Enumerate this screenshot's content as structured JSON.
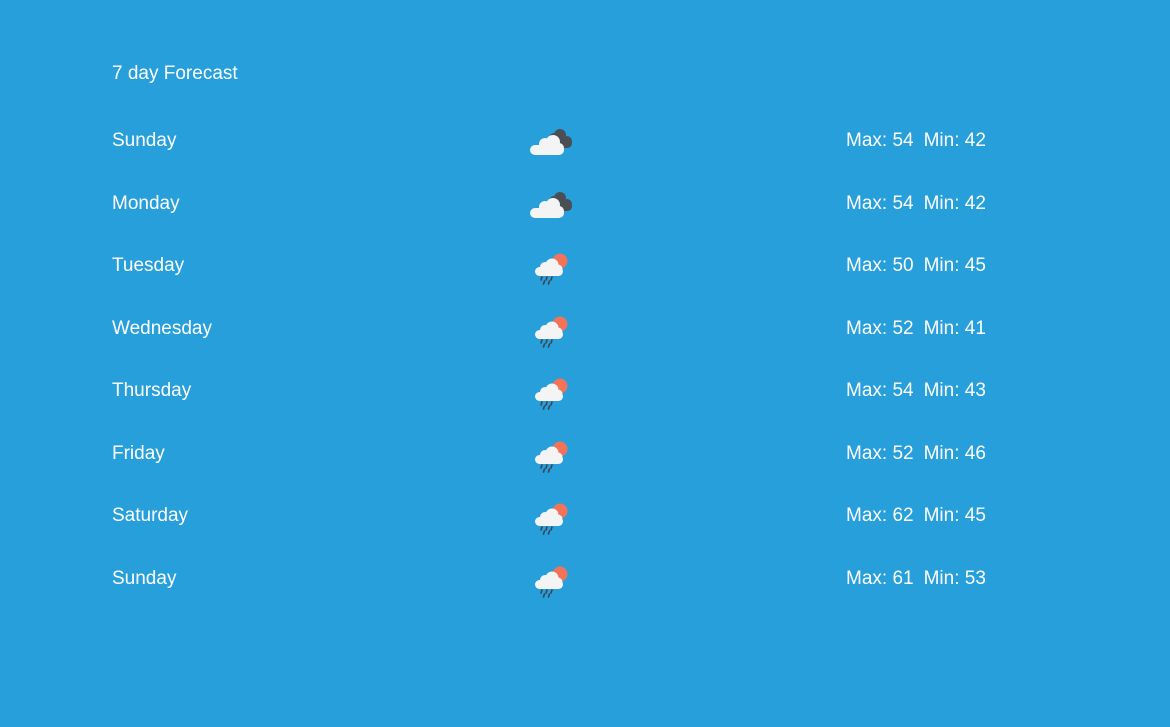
{
  "header": {
    "title": "7 day Forecast"
  },
  "days": [
    {
      "day": "Sunday",
      "icon": "cloudy-icon",
      "max": "Max: 54",
      "min": "Min: 42"
    },
    {
      "day": "Monday",
      "icon": "cloudy-icon",
      "max": "Max: 54",
      "min": "Min: 42"
    },
    {
      "day": "Tuesday",
      "icon": "rain-sun-icon",
      "max": "Max: 50",
      "min": "Min: 45"
    },
    {
      "day": "Wednesday",
      "icon": "rain-sun-icon",
      "max": "Max: 52",
      "min": "Min: 41"
    },
    {
      "day": "Thursday",
      "icon": "rain-sun-icon",
      "max": "Max: 54",
      "min": "Min: 43"
    },
    {
      "day": "Friday",
      "icon": "rain-sun-icon",
      "max": "Max: 52",
      "min": "Min: 46"
    },
    {
      "day": "Saturday",
      "icon": "rain-sun-icon",
      "max": "Max: 62",
      "min": "Min: 45"
    },
    {
      "day": "Sunday",
      "icon": "rain-sun-icon",
      "max": "Max: 61",
      "min": "Min: 53"
    }
  ],
  "colors": {
    "background": "#269fdb",
    "text": "#ffffff",
    "cloud_light": "#f4f4f4",
    "cloud_dark": "#4a4f56",
    "sun": "#f2735a",
    "rain": "#3c4452"
  }
}
